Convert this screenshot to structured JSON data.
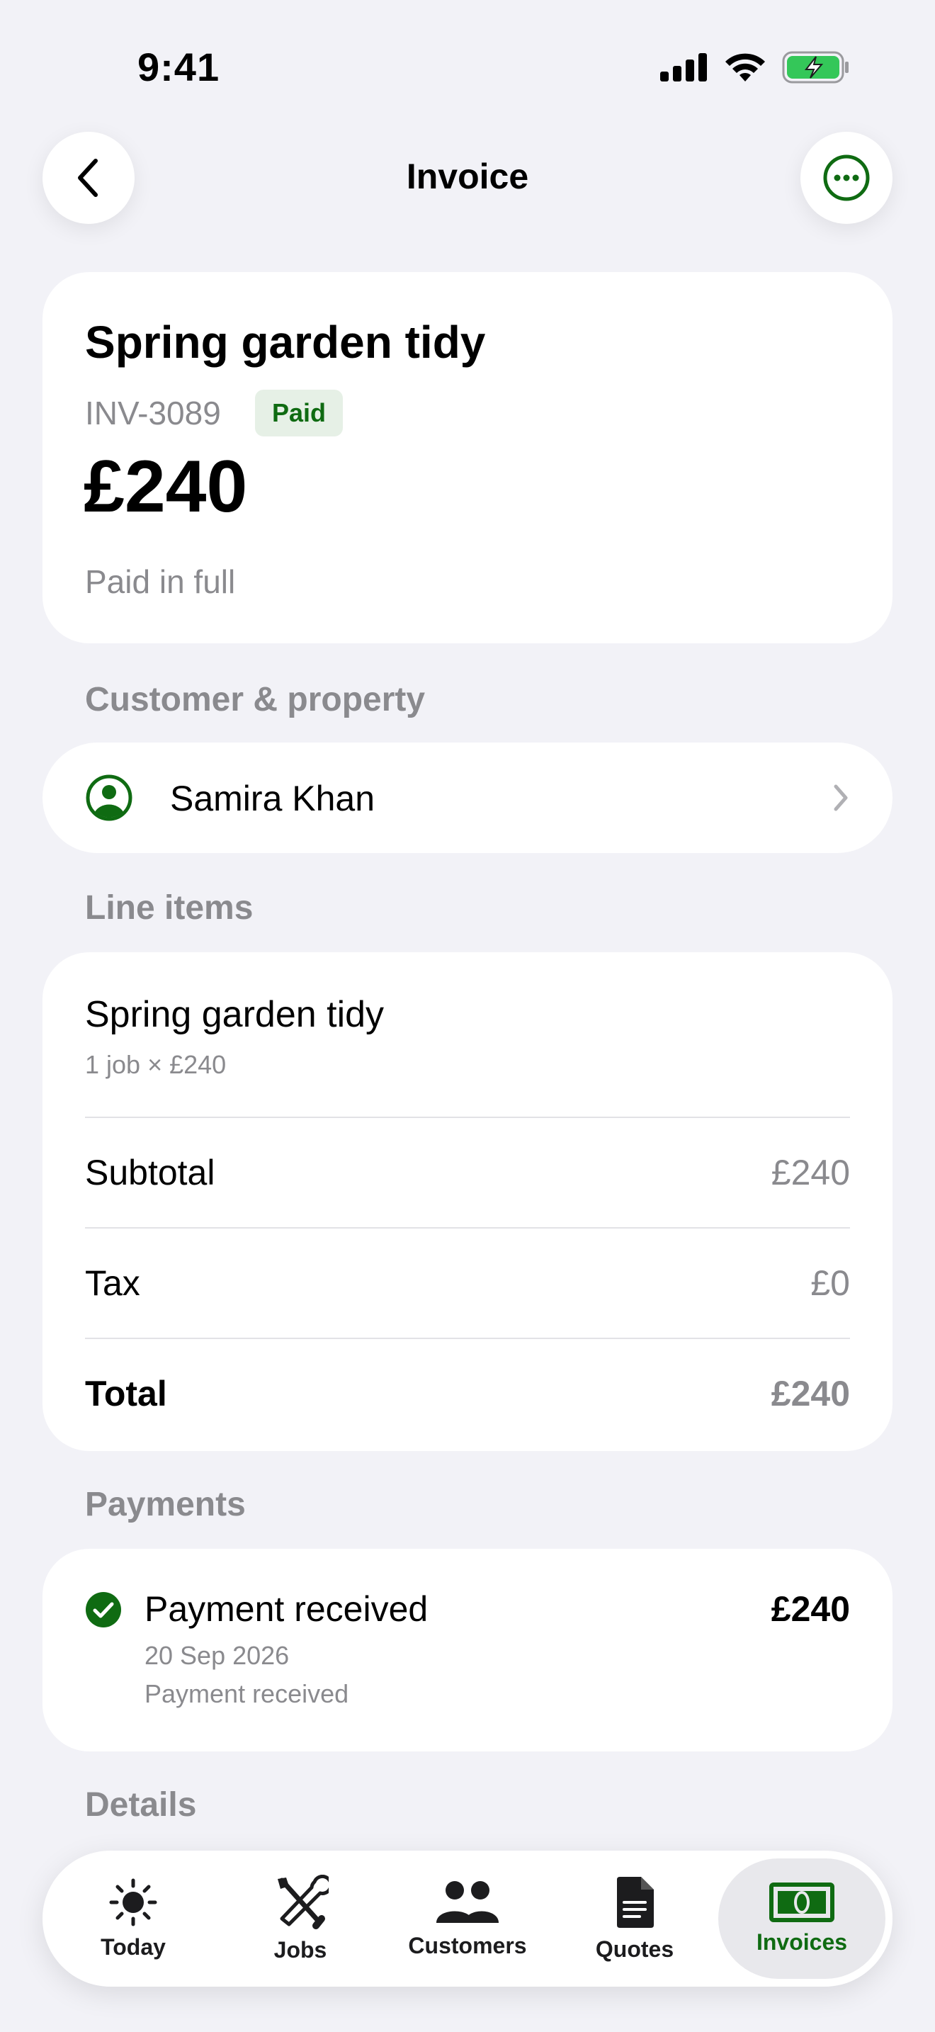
{
  "status": {
    "time": "9:41"
  },
  "nav": {
    "title": "Invoice"
  },
  "invoice": {
    "title": "Spring garden tidy",
    "number": "INV-3089",
    "badge": "Paid",
    "amount": "£240",
    "status_text": "Paid in full"
  },
  "customer_section": {
    "label": "Customer & property",
    "name": "Samira Khan"
  },
  "lines_section": {
    "label": "Line items",
    "item_title": "Spring garden tidy",
    "item_sub": "1 job × £240",
    "subtotal_label": "Subtotal",
    "subtotal_value": "£240",
    "tax_label": "Tax",
    "tax_value": "£0",
    "total_label": "Total",
    "total_value": "£240"
  },
  "payments_section": {
    "label": "Payments",
    "title": "Payment received",
    "amount": "£240",
    "date": "20 Sep 2026",
    "note": "Payment received"
  },
  "details_section": {
    "label": "Details"
  },
  "tabs": [
    {
      "label": "Today",
      "icon": "sun-icon"
    },
    {
      "label": "Jobs",
      "icon": "tools-icon"
    },
    {
      "label": "Customers",
      "icon": "people-icon"
    },
    {
      "label": "Quotes",
      "icon": "document-icon"
    },
    {
      "label": "Invoices",
      "icon": "banknote-icon",
      "active": true
    }
  ],
  "colors": {
    "accent": "#0f6b12",
    "background": "#f2f2f7",
    "badge_bg": "#e6f0e6"
  }
}
